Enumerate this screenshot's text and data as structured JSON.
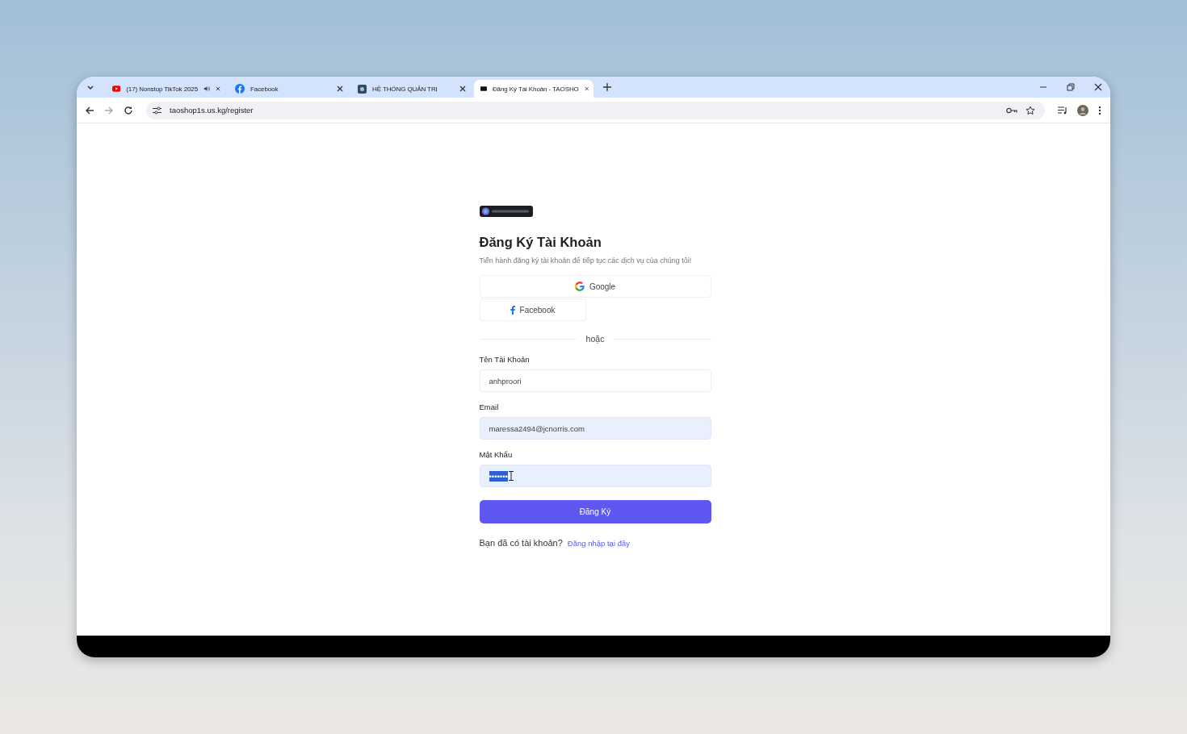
{
  "tabs": [
    {
      "title": "(17) Nonstop TikTok 2025",
      "kind": "video",
      "audio": true,
      "selected": false
    },
    {
      "title": "Facebook",
      "kind": "facebook",
      "audio": false,
      "selected": false
    },
    {
      "title": "HỆ THỐNG QUẢN TRỊ",
      "kind": "admin",
      "audio": false,
      "selected": false
    },
    {
      "title": "Đăng Ký Tài Khoản - TAOSHO",
      "kind": "site",
      "audio": false,
      "selected": true
    }
  ],
  "address": {
    "url": "taoshop1s.us.kg/register"
  },
  "page": {
    "title": "Đăng Ký Tài Khoản",
    "subtitle": "Tiến hành đăng ký tài khoản để tiếp tục các dịch vụ của chúng tôi!",
    "social": [
      {
        "label": "Google",
        "kind": "google"
      },
      {
        "label": "Facebook",
        "kind": "facebook"
      }
    ],
    "divider": "hoặc",
    "fields": [
      {
        "label": "Tên Tài Khoản",
        "value": "anhproori",
        "autofilled": false,
        "selected": false
      },
      {
        "label": "Email",
        "value": "maressa2494@jcnorris.com",
        "autofilled": true,
        "selected": false
      },
      {
        "label": "Mật Khẩu",
        "value": "•••••••",
        "autofilled": true,
        "selected": true
      }
    ],
    "submit": "Đăng Ký",
    "footer": {
      "text": "Bạn đã có tài khoản?",
      "link": "Đăng nhập tại đây"
    }
  }
}
